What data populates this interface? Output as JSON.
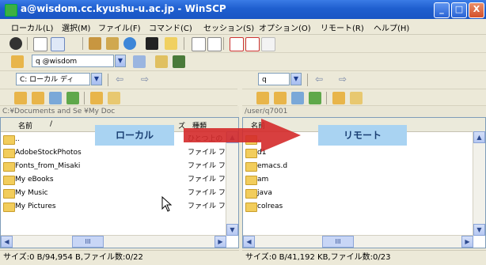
{
  "window": {
    "title": "a@wisdom.cc.kyushu-u.ac.jp - WinSCP",
    "minimize": "_",
    "maximize": "□",
    "close": "X"
  },
  "menu": [
    "ローカル(L)",
    "選択(M)",
    "ファイル(F)",
    "コマンド(C)",
    "セッション(S)",
    "オプション(O)",
    "リモート(R)",
    "ヘルプ(H)"
  ],
  "session": {
    "combo_value": "q        @wisdom"
  },
  "local": {
    "drive_combo": "C: ローカル ディ",
    "path": "C:¥Documents and Se                              ¥My Doc",
    "columns": {
      "name": "名前",
      "sort": "/",
      "size": "ズ",
      "type": "種類"
    },
    "overlay_label": "ローカル",
    "files": [
      {
        "name": "..",
        "type": "ひとつ上の"
      },
      {
        "name": "AdobeStockPhotos",
        "type": "ファイル フ:"
      },
      {
        "name": "Fonts_from_Misaki",
        "type": "ファイル フ:"
      },
      {
        "name": "My eBooks",
        "type": "ファイル フ:"
      },
      {
        "name": "My Music",
        "type": "ファイル フ:"
      },
      {
        "name": "My Pictures",
        "type": "ファイル フ:"
      }
    ],
    "scroll_label": "III",
    "status": "サイズ:0 B/94,954 B,ファイル数:0/22"
  },
  "remote": {
    "dir_combo": "q",
    "path": "/user/q7001",
    "columns": {
      "name": "名前"
    },
    "overlay_label": "リモート",
    "files": [
      {
        "name": ".."
      },
      {
        "name": "d1"
      },
      {
        "name": "emacs.d"
      },
      {
        "name": "am"
      },
      {
        "name": "java"
      },
      {
        "name": "colreas"
      }
    ],
    "scroll_label": "III",
    "status": "サイズ:0 B/41,192 KB,ファイル数:0/23"
  },
  "colors": {
    "titlebar": "#1f5fcf",
    "overlay": "#a9d3f2",
    "arrow": "#d42a2a"
  },
  "icons": [
    "settings-icon",
    "open-icon",
    "copy-icon",
    "sync-icon",
    "terminal-icon",
    "new-folder-icon",
    "filter-icon"
  ]
}
